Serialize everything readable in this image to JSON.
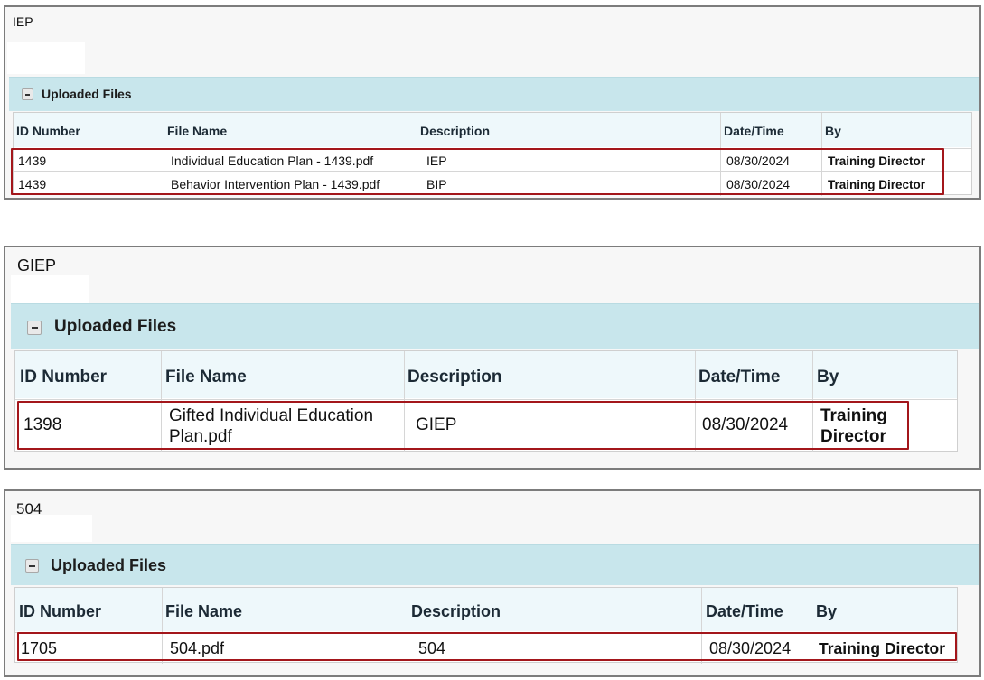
{
  "panels": [
    {
      "title": "IEP",
      "section_title": "Uploaded Files",
      "columns": [
        "ID Number",
        "File Name",
        "Description",
        "Date/Time",
        "By"
      ],
      "rows": [
        {
          "id": "1439",
          "file": "Individual Education Plan - 1439.pdf",
          "desc": "IEP",
          "date": "08/30/2024",
          "by": "Training Director"
        },
        {
          "id": "1439",
          "file": "Behavior Intervention Plan - 1439.pdf",
          "desc": "BIP",
          "date": "08/30/2024",
          "by": "Training Director"
        }
      ]
    },
    {
      "title": "GIEP",
      "section_title": "Uploaded Files",
      "columns": [
        "ID Number",
        "File Name",
        "Description",
        "Date/Time",
        "By"
      ],
      "rows": [
        {
          "id": "1398",
          "file_line1": "Gifted Individual Education",
          "file_line2": "Plan.pdf",
          "desc": "GIEP",
          "date": "08/30/2024",
          "by_line1": "Training",
          "by_line2": "Director"
        }
      ]
    },
    {
      "title": "504",
      "section_title": "Uploaded Files",
      "columns": [
        "ID Number",
        "File Name",
        "Description",
        "Date/Time",
        "By"
      ],
      "rows": [
        {
          "id": "1705",
          "file": "504.pdf",
          "desc": "504",
          "date": "08/30/2024",
          "by": "Training Director"
        }
      ]
    }
  ],
  "colors": {
    "header_bg": "#c8e6ec",
    "highlight_border": "#a3161b"
  }
}
